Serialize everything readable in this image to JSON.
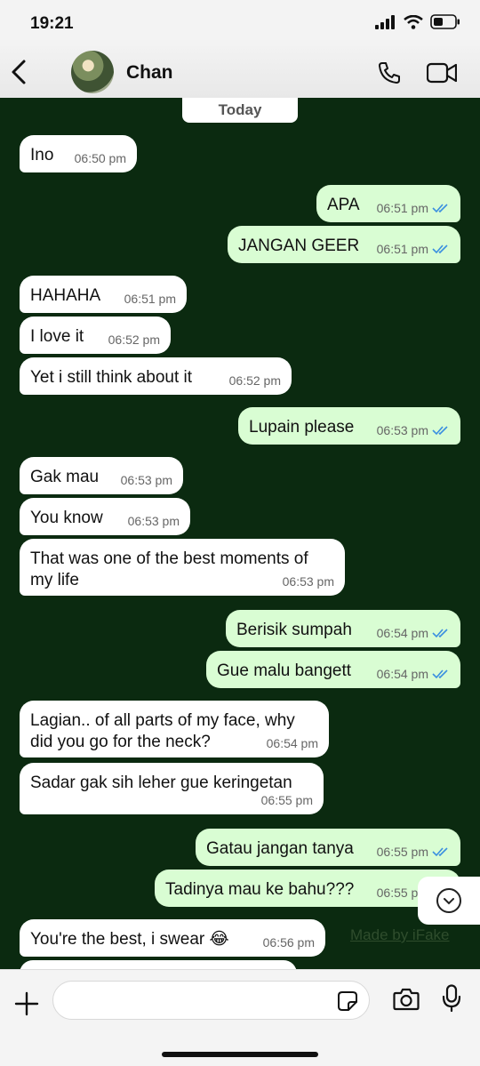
{
  "status_bar": {
    "time": "19:21"
  },
  "header": {
    "contact_name": "Chan"
  },
  "date_chip": "Today",
  "messages": [
    {
      "dir": "in",
      "text": "Ino",
      "time": "06:50 pm"
    },
    {
      "dir": "out",
      "text": "APA",
      "time": "06:51 pm"
    },
    {
      "dir": "out",
      "text": "JANGAN GEER",
      "time": "06:51 pm"
    },
    {
      "dir": "in",
      "text": "HAHAHA",
      "time": "06:51 pm"
    },
    {
      "dir": "in",
      "text": "I love it",
      "time": "06:52 pm"
    },
    {
      "dir": "in",
      "text": "Yet i still think about it",
      "time": "06:52 pm"
    },
    {
      "dir": "out",
      "text": "Lupain please",
      "time": "06:53 pm"
    },
    {
      "dir": "in",
      "text": "Gak mau",
      "time": "06:53 pm"
    },
    {
      "dir": "in",
      "text": "You know",
      "time": "06:53 pm"
    },
    {
      "dir": "in",
      "text": "That was one of the best moments of my life",
      "time": "06:53 pm"
    },
    {
      "dir": "out",
      "text": "Berisik sumpah",
      "time": "06:54 pm"
    },
    {
      "dir": "out",
      "text": "Gue malu bangett",
      "time": "06:54 pm"
    },
    {
      "dir": "in",
      "text": "Lagian.. of all parts of my face, why did you go for the neck?",
      "time": "06:54 pm"
    },
    {
      "dir": "in",
      "text": "Sadar gak sih leher gue keringetan",
      "time": "06:55 pm"
    },
    {
      "dir": "out",
      "text": "Gatau jangan tanya",
      "time": "06:55 pm"
    },
    {
      "dir": "out",
      "text": "Tadinya mau ke bahu???",
      "time": "06:55 pm"
    },
    {
      "dir": "in",
      "text": "You're the best, i swear 😂",
      "time": "06:56 pm"
    }
  ],
  "watermark": "Made by iFake",
  "colors": {
    "chat_bg": "#0b2a10",
    "outgoing": "#d9fdd3",
    "incoming": "#ffffff",
    "read_tick": "#3a8fe0"
  }
}
